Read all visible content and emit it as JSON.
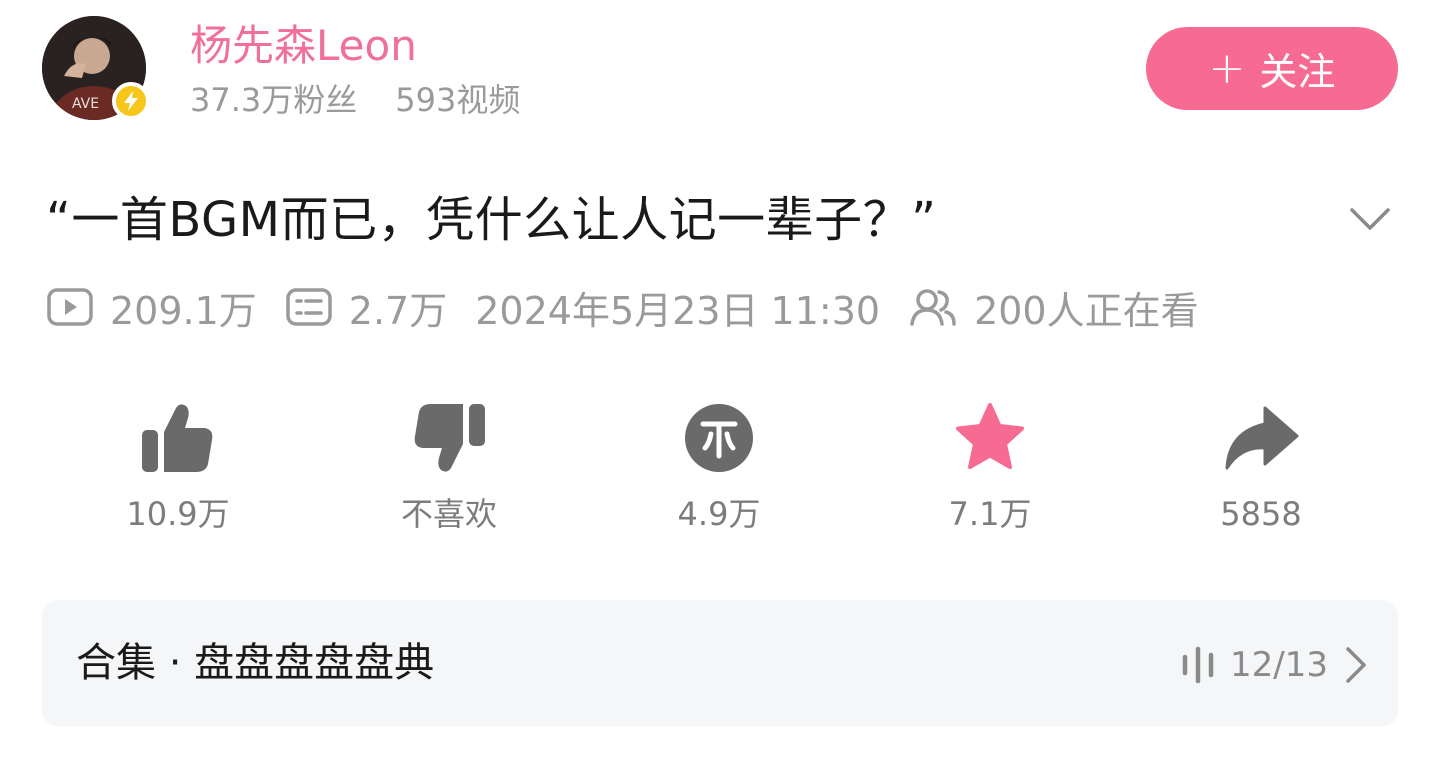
{
  "header": {
    "username": "杨先森Leon",
    "followers": "37.3万粉丝",
    "videos": "593视频",
    "follow_label": "关注",
    "follow_plus": "+"
  },
  "video": {
    "title": "“一首BGM而已，凭什么让人记一辈子？”",
    "views": "209.1万",
    "danmaku": "2.7万",
    "datetime": "2024年5月23日 11:30",
    "watching": "200人正在看"
  },
  "actions": {
    "like": "10.9万",
    "dislike": "不喜欢",
    "coin": "4.9万",
    "favorite": "7.1万",
    "share": "5858"
  },
  "collection": {
    "title": "合集 · 盘盘盘盘盘典",
    "progress": "12/13"
  },
  "colors": {
    "accent_pink": "#f76a92",
    "username_pink": "#f0709a",
    "favorite_pink": "#f76a92",
    "icon_gray": "#6a6a6a",
    "meta_gray": "#9a9a9a",
    "verify_yellow": "#f7c61b"
  },
  "icons": {
    "verify": "lightning-bolt-icon",
    "views": "play-icon",
    "danmaku": "danmaku-icon",
    "watching": "people-icon",
    "like": "thumbs-up-icon",
    "dislike": "thumbs-down-icon",
    "coin": "coin-icon",
    "favorite": "star-icon",
    "share": "share-arrow-icon",
    "expand": "chevron-down-icon",
    "collection_progress": "playlist-bars-icon",
    "collection_arrow": "chevron-right-icon"
  }
}
